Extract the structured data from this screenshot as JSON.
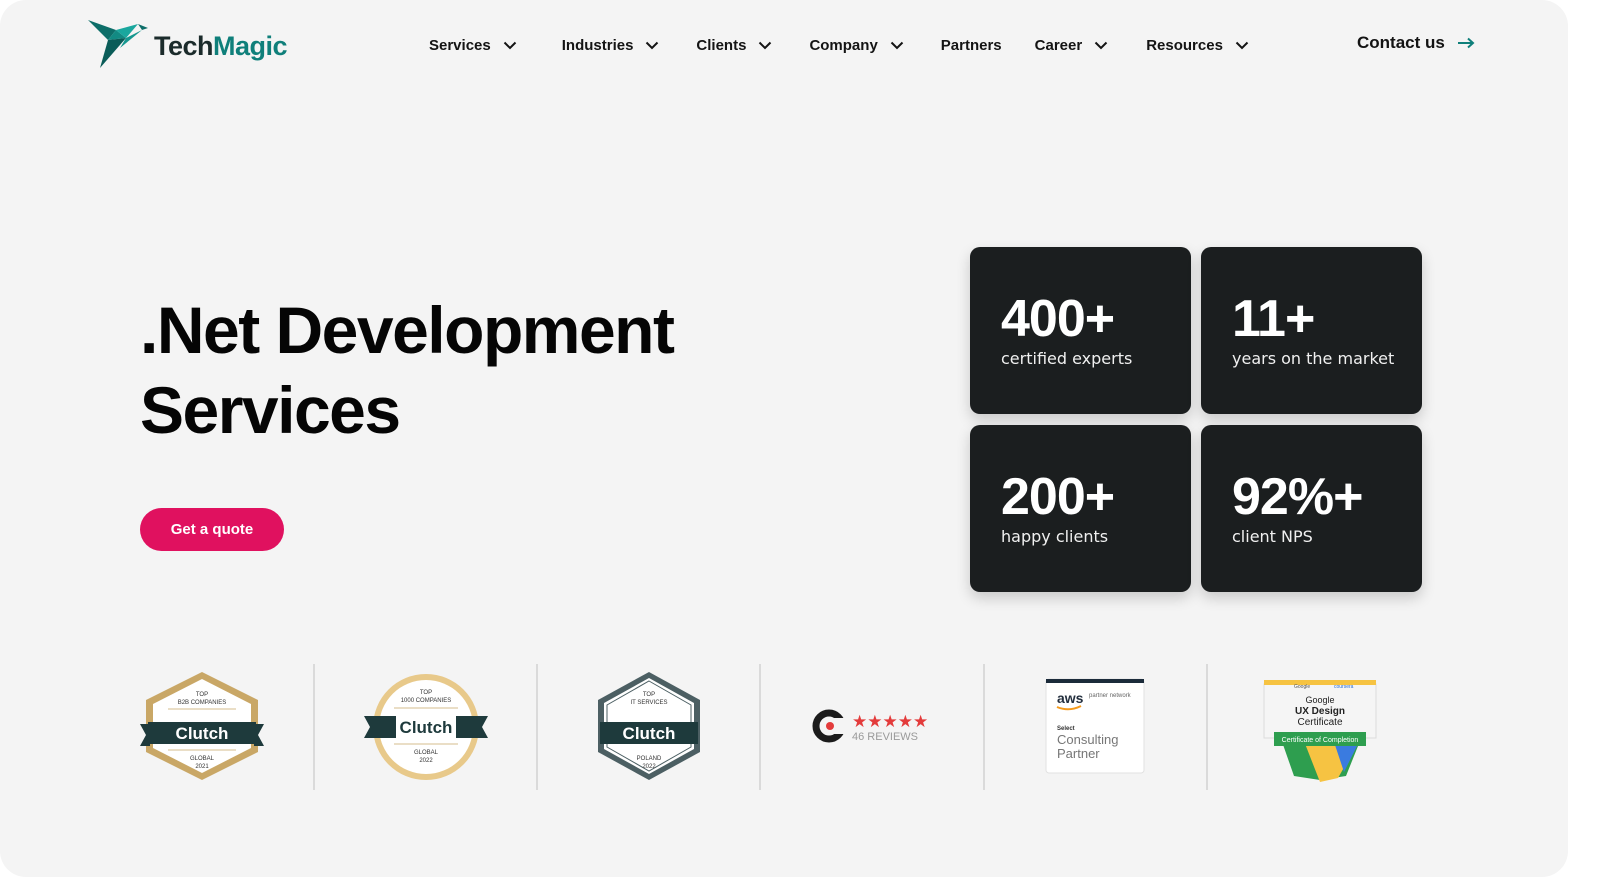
{
  "header": {
    "logo": {
      "part1": "Tech",
      "part2": "Magic",
      "icon": "hummingbird-logo-icon"
    },
    "nav": [
      {
        "label": "Services",
        "has_dropdown": true
      },
      {
        "label": "Industries",
        "has_dropdown": true
      },
      {
        "label": "Clients",
        "has_dropdown": true
      },
      {
        "label": "Company",
        "has_dropdown": true
      },
      {
        "label": "Partners",
        "has_dropdown": false
      },
      {
        "label": "Career",
        "has_dropdown": true
      },
      {
        "label": "Resources",
        "has_dropdown": true
      }
    ],
    "contact": {
      "label": "Contact us",
      "icon": "arrow-right-icon"
    }
  },
  "hero": {
    "title_line1": ".Net Development",
    "title_line2": "Services",
    "cta_label": "Get a quote"
  },
  "stats": [
    {
      "value": "400+",
      "label": "certified experts"
    },
    {
      "value": "11+",
      "label": "years on the market"
    },
    {
      "value": "200+",
      "label": "happy clients"
    },
    {
      "value": "92%+",
      "label": "client NPS"
    }
  ],
  "badges": {
    "clutch1": {
      "top": "TOP",
      "sub": "B2B COMPANIES",
      "word": "Clutch",
      "region": "GLOBAL",
      "year": "2021"
    },
    "clutch2": {
      "top": "TOP",
      "sub": "1000 COMPANIES",
      "word": "Clutch",
      "region": "GLOBAL",
      "year": "2022"
    },
    "clutch3": {
      "top": "TOP",
      "sub": "IT SERVICES",
      "word": "Clutch",
      "region": "POLAND",
      "year": "2022"
    },
    "clutch_reviews": {
      "stars": "★★★★★",
      "reviews": "46 REVIEWS",
      "rating": 5
    },
    "aws": {
      "brand": "aws",
      "network": "partner network",
      "tier": "Select",
      "line1": "Consulting",
      "line2": "Partner"
    },
    "google": {
      "brand1": "Google",
      "brand2": "coursera",
      "line1": "Google",
      "line2": "UX Design",
      "line3": "Certificate",
      "ribbon": "Certificate of Completion"
    }
  },
  "colors": {
    "accent": "#e0115f",
    "brand_teal": "#0f7f7a",
    "stat_bg": "#1b1e1f",
    "page_bg": "#f4f4f4"
  }
}
